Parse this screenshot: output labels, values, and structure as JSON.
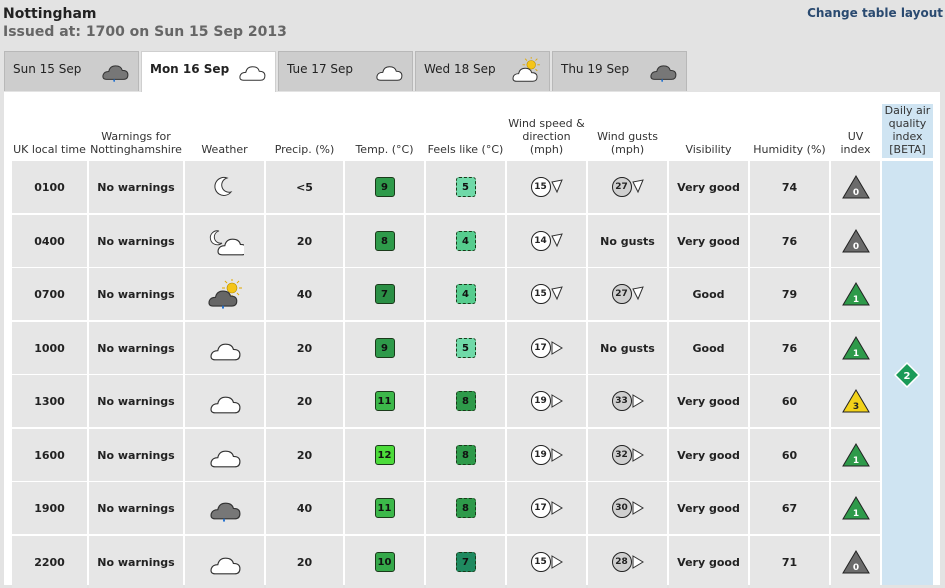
{
  "header": {
    "location": "Nottingham",
    "issued": "Issued at: 1700 on Sun 15 Sep 2013",
    "change_layout": "Change table layout"
  },
  "tabs": [
    {
      "label": "Sun 15 Sep",
      "icon": "rain-cloud-icon",
      "active": false
    },
    {
      "label": "Mon 16 Sep",
      "icon": "cloud-icon",
      "active": true
    },
    {
      "label": "Tue 17 Sep",
      "icon": "cloud-icon",
      "active": false
    },
    {
      "label": "Wed 18 Sep",
      "icon": "sun-cloud-icon",
      "active": false
    },
    {
      "label": "Thu 19 Sep",
      "icon": "rain-cloud-icon",
      "active": false
    }
  ],
  "columns": {
    "time": "UK local time",
    "warnings": "Warnings for Nottinghamshire",
    "weather": "Weather",
    "precip": "Precip. (%)",
    "temp": "Temp. (°C)",
    "feels": "Feels like (°C)",
    "wind": "Wind speed & direction (mph)",
    "gusts": "Wind gusts (mph)",
    "visibility": "Visibility",
    "humidity": "Humidity (%)",
    "uv": "UV index",
    "aq": "Daily air quality index [BETA]"
  },
  "air_quality": {
    "value": "2",
    "color": "#1a9a58"
  },
  "rows": [
    {
      "time": "0100",
      "warnings": "No warnings",
      "weather": "moon-icon",
      "precip": "<5",
      "temp": "9",
      "temp_color": "#2e9a4a",
      "feels": "5",
      "feels_color": "#6fd9a8",
      "wind": "15",
      "wind_dir": "nw",
      "gusts": "27",
      "gusts_dir": "nw",
      "visibility": "Very good",
      "humidity": "74",
      "uv": "0",
      "uv_color": "#6b6b6b"
    },
    {
      "time": "0400",
      "warnings": "No warnings",
      "weather": "moon-cloud-icon",
      "precip": "20",
      "temp": "8",
      "temp_color": "#2e9a4a",
      "feels": "4",
      "feels_color": "#56cc8e",
      "wind": "14",
      "wind_dir": "nw",
      "gusts": "No gusts",
      "gusts_dir": "",
      "visibility": "Very good",
      "humidity": "76",
      "uv": "0",
      "uv_color": "#6b6b6b"
    },
    {
      "time": "0700",
      "warnings": "No warnings",
      "weather": "sun-rain-cloud-icon",
      "precip": "40",
      "temp": "7",
      "temp_color": "#2a8f45",
      "feels": "4",
      "feels_color": "#56cc8e",
      "wind": "15",
      "wind_dir": "nw",
      "gusts": "27",
      "gusts_dir": "nw",
      "visibility": "Good",
      "humidity": "79",
      "uv": "1",
      "uv_color": "#2e9a4a"
    },
    {
      "time": "1000",
      "warnings": "No warnings",
      "weather": "cloud-icon",
      "precip": "20",
      "temp": "9",
      "temp_color": "#2e9a4a",
      "feels": "5",
      "feels_color": "#6fd9a8",
      "wind": "17",
      "wind_dir": "w",
      "gusts": "No gusts",
      "gusts_dir": "",
      "visibility": "Good",
      "humidity": "76",
      "uv": "1",
      "uv_color": "#2e9a4a"
    },
    {
      "time": "1300",
      "warnings": "No warnings",
      "weather": "cloud-icon",
      "precip": "20",
      "temp": "11",
      "temp_color": "#3cb84a",
      "feels": "8",
      "feels_color": "#2e9a4a",
      "wind": "19",
      "wind_dir": "w",
      "gusts": "33",
      "gusts_dir": "w",
      "visibility": "Very good",
      "humidity": "60",
      "uv": "3",
      "uv_color": "#f2d21a"
    },
    {
      "time": "1600",
      "warnings": "No warnings",
      "weather": "cloud-icon",
      "precip": "20",
      "temp": "12",
      "temp_color": "#4cdb3a",
      "feels": "8",
      "feels_color": "#2e9a4a",
      "wind": "19",
      "wind_dir": "w",
      "gusts": "32",
      "gusts_dir": "w",
      "visibility": "Very good",
      "humidity": "60",
      "uv": "1",
      "uv_color": "#2e9a4a"
    },
    {
      "time": "1900",
      "warnings": "No warnings",
      "weather": "rain-cloud-icon",
      "precip": "40",
      "temp": "11",
      "temp_color": "#3cb84a",
      "feels": "8",
      "feels_color": "#2e9a4a",
      "wind": "17",
      "wind_dir": "w",
      "gusts": "30",
      "gusts_dir": "w",
      "visibility": "Very good",
      "humidity": "67",
      "uv": "1",
      "uv_color": "#2e9a4a"
    },
    {
      "time": "2200",
      "warnings": "No warnings",
      "weather": "cloud-icon",
      "precip": "20",
      "temp": "10",
      "temp_color": "#35a84a",
      "feels": "7",
      "feels_color": "#1f8a60",
      "wind": "15",
      "wind_dir": "w",
      "gusts": "28",
      "gusts_dir": "w",
      "visibility": "Very good",
      "humidity": "71",
      "uv": "0",
      "uv_color": "#6b6b6b"
    }
  ]
}
